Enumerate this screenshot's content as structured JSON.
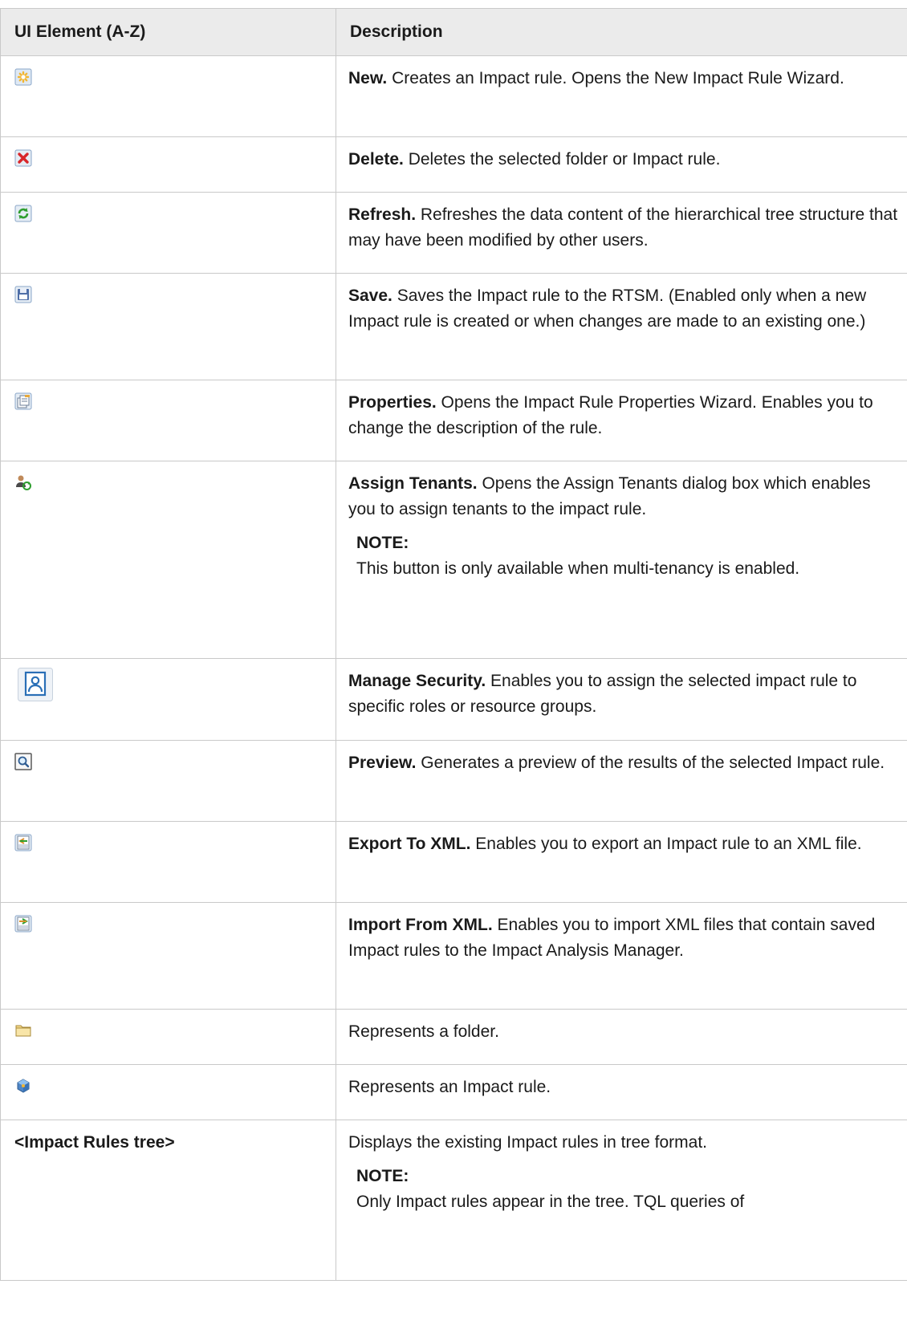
{
  "table": {
    "headers": [
      "UI Element (A-Z)",
      "Description"
    ],
    "rows": [
      {
        "icon": "new-icon",
        "term": "New.",
        "text": " Creates an Impact rule. Opens the New Impact Rule Wizard."
      },
      {
        "icon": "delete-icon",
        "term": "Delete.",
        "text": " Deletes the selected folder or Impact rule."
      },
      {
        "icon": "refresh-icon",
        "term": "Refresh.",
        "text": " Refreshes the data content of the hierarchical tree structure that may have been modified by other users."
      },
      {
        "icon": "save-icon",
        "term": "Save.",
        "text": " Saves the Impact rule to the RTSM. (Enabled only when a new Impact rule is created or when changes are made to an existing one.)"
      },
      {
        "icon": "properties-icon",
        "term": "Properties.",
        "text": " Opens the Impact Rule Properties Wizard. Enables you to change the description of the rule."
      },
      {
        "icon": "assign-tenants-icon",
        "term": "Assign Tenants.",
        "text": " Opens the Assign Tenants dialog box which enables you to assign tenants to the impact rule.",
        "note_label": "NOTE:",
        "note": "This button is only available when multi-tenancy is enabled."
      },
      {
        "icon": "manage-security-icon",
        "term": "Manage Security.",
        "text": " Enables you to assign the selected impact rule to specific roles or resource groups."
      },
      {
        "icon": "preview-icon",
        "term": "Preview.",
        "text": " Generates a preview of the results of the selected Impact rule."
      },
      {
        "icon": "export-xml-icon",
        "term": "Export To XML.",
        "text": " Enables you to export an Impact rule to an XML file."
      },
      {
        "icon": "import-xml-icon",
        "term": "Import From XML.",
        "text": " Enables you to import XML files that contain saved Impact rules to the Impact Analysis Manager."
      },
      {
        "icon": "folder-icon",
        "text": "Represents a folder."
      },
      {
        "icon": "impact-rule-icon",
        "text": "Represents an Impact rule."
      },
      {
        "element": "<Impact Rules tree>",
        "text": "Displays the existing Impact rules in tree format.",
        "note_label": "NOTE:",
        "note": "Only Impact rules appear in the tree. TQL queries of"
      }
    ]
  },
  "colors": {
    "header_bg": "#ebebeb",
    "border": "#c9c9c9"
  }
}
